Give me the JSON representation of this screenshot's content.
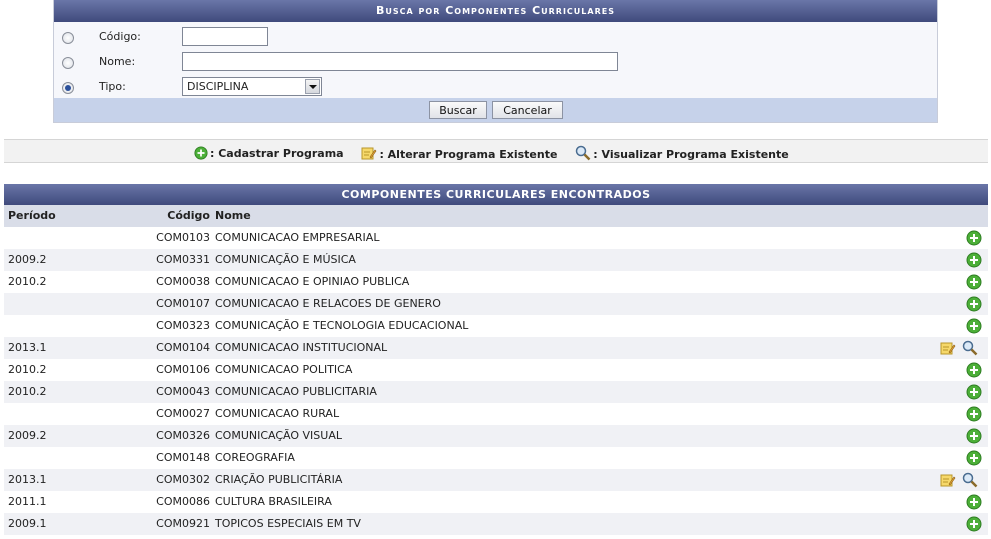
{
  "search": {
    "title": "Busca por Componentes Curriculares",
    "codigo_label": "Código:",
    "codigo_value": "",
    "nome_label": "Nome:",
    "nome_value": "",
    "tipo_label": "Tipo:",
    "tipo_value": "DISCIPLINA",
    "selected_criterion": "tipo",
    "buscar_label": "Buscar",
    "cancelar_label": "Cancelar"
  },
  "legend": {
    "cadastrar": ": Cadastrar Programa",
    "alterar": ": Alterar Programa Existente",
    "visualizar": ": Visualizar Programa Existente"
  },
  "results": {
    "title": "COMPONENTES CURRICULARES ENCONTRADOS",
    "headers": {
      "periodo": "Período",
      "codigo": "Código",
      "nome": "Nome"
    },
    "rows": [
      {
        "periodo": "",
        "codigo": "COM0103",
        "nome": "COMUNICACAO EMPRESARIAL",
        "actions": [
          "add"
        ]
      },
      {
        "periodo": "2009.2",
        "codigo": "COM0331",
        "nome": "COMUNICAÇÃO E MÚSICA",
        "actions": [
          "add"
        ]
      },
      {
        "periodo": "2010.2",
        "codigo": "COM0038",
        "nome": "COMUNICACAO E OPINIAO PUBLICA",
        "actions": [
          "add"
        ]
      },
      {
        "periodo": "",
        "codigo": "COM0107",
        "nome": "COMUNICACAO E RELACOES DE GENERO",
        "actions": [
          "add"
        ]
      },
      {
        "periodo": "",
        "codigo": "COM0323",
        "nome": "COMUNICAÇÃO E TECNOLOGIA EDUCACIONAL",
        "actions": [
          "add"
        ]
      },
      {
        "periodo": "2013.1",
        "codigo": "COM0104",
        "nome": "COMUNICACAO INSTITUCIONAL",
        "actions": [
          "edit",
          "view"
        ]
      },
      {
        "periodo": "2010.2",
        "codigo": "COM0106",
        "nome": "COMUNICACAO POLITICA",
        "actions": [
          "add"
        ]
      },
      {
        "periodo": "2010.2",
        "codigo": "COM0043",
        "nome": "COMUNICACAO PUBLICITARIA",
        "actions": [
          "add"
        ]
      },
      {
        "periodo": "",
        "codigo": "COM0027",
        "nome": "COMUNICACAO RURAL",
        "actions": [
          "add"
        ]
      },
      {
        "periodo": "2009.2",
        "codigo": "COM0326",
        "nome": "COMUNICAÇÃO VISUAL",
        "actions": [
          "add"
        ]
      },
      {
        "periodo": "",
        "codigo": "COM0148",
        "nome": "COREOGRAFIA",
        "actions": [
          "add"
        ]
      },
      {
        "periodo": "2013.1",
        "codigo": "COM0302",
        "nome": "CRIAÇÃO PUBLICITÁRIA",
        "actions": [
          "edit",
          "view"
        ]
      },
      {
        "periodo": "2011.1",
        "codigo": "COM0086",
        "nome": "CULTURA BRASILEIRA",
        "actions": [
          "add"
        ]
      },
      {
        "periodo": "2009.1",
        "codigo": "COM0921",
        "nome": "TOPICOS ESPECIAIS EM TV",
        "actions": [
          "add"
        ]
      }
    ]
  },
  "icons": {
    "add": "plus-circle-icon",
    "edit": "edit-note-icon",
    "view": "magnifier-icon"
  },
  "colors": {
    "header_blue": "#4a5588",
    "button_bar": "#c6d2ea",
    "add_green": "#4caf38"
  }
}
